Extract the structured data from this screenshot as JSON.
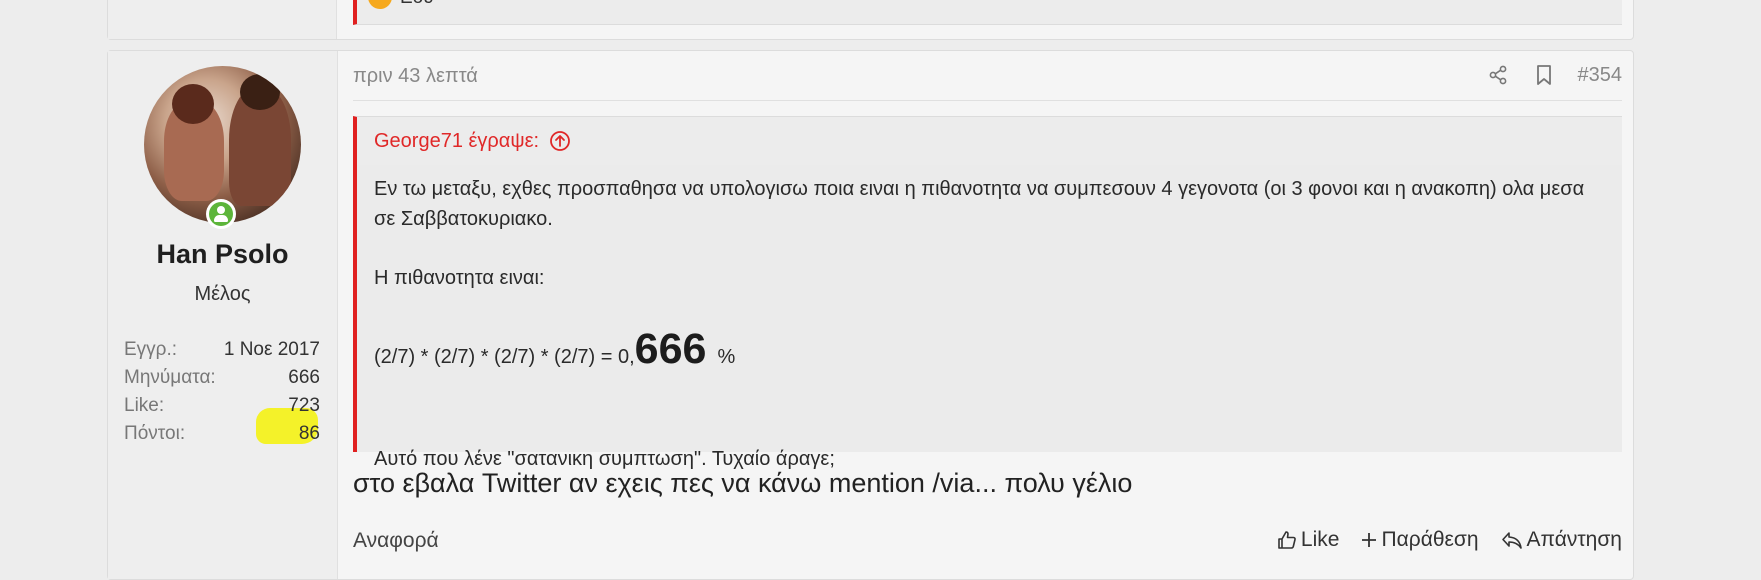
{
  "prev_post": {
    "snippet_text": "Εου"
  },
  "post": {
    "user": {
      "name": "Han Psolo",
      "title": "Μέλος",
      "stats": [
        {
          "label": "Εγγρ.:",
          "value": "1 Νοε 2017"
        },
        {
          "label": "Μηνύματα:",
          "value": "666"
        },
        {
          "label": "Like:",
          "value": "723"
        },
        {
          "label": "Πόντοι:",
          "value": "86"
        }
      ]
    },
    "time": "πριν 43 λεπτά",
    "post_number": "#354",
    "quote": {
      "author_label": "George71 έγραψε:",
      "p1": "Εν τω μεταξυ, εχθες προσπαθησα να υπολογισω ποια ειναι η πιθανοτητα να συμπεσουν 4 γεγονοτα (οι 3 φονοι και η ανακοπη) ολα μεσα σε Σαββατοκυριακο.",
      "p2": "Η πιθανοτητα ειναι:",
      "formula_prefix": "(2/7) * (2/7) * (2/7) * (2/7) = 0,",
      "formula_big": "666",
      "formula_suffix": "%",
      "p4": "Αυτό που λένε \"σατανικη συμπτωση\". Τυχαίο άραγε;"
    },
    "reply_text": "στο εβαλα Twitter αν εχεις πες να κάνω mention /via... πολυ γέλιο",
    "footer": {
      "report_label": "Αναφορά",
      "like_label": "Like",
      "quote_label": "Παράθεση",
      "reply_label": "Απάντηση"
    }
  },
  "colors": {
    "accent_red": "#e02020",
    "highlight_yellow": "#f3f11e",
    "online_green": "#5cb53a"
  },
  "icons": [
    "share-icon",
    "bookmark-icon",
    "arrow-up-circle-icon",
    "thumbs-up-icon",
    "plus-icon",
    "reply-icon",
    "online-status-icon",
    "sad-emoji-icon"
  ]
}
